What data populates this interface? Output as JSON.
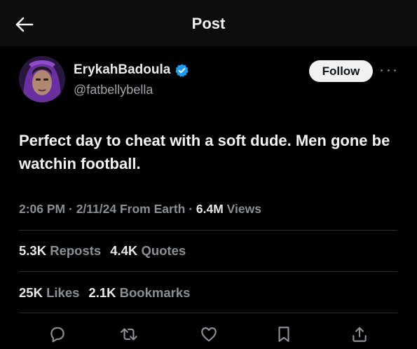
{
  "header": {
    "title": "Post",
    "back_icon": "arrow-left-icon"
  },
  "author": {
    "name": "ErykahBadoula",
    "handle": "@fatbellybella",
    "verified_icon": "verified-badge-icon",
    "verified_color": "#1d9bf0"
  },
  "follow_label": "Follow",
  "post": {
    "text": "Perfect day to cheat with a soft dude. Men gone be watchin football."
  },
  "meta": {
    "time": "2:06 PM",
    "sep1": " · ",
    "date": "2/11/24",
    "location": " From Earth",
    "sep2": " · ",
    "views_count": "6.4M",
    "views_label": " Views"
  },
  "stats": {
    "reposts_count": "5.3K",
    "reposts_label": "Reposts",
    "quotes_count": "4.4K",
    "quotes_label": "Quotes",
    "likes_count": "25K",
    "likes_label": "Likes",
    "bookmarks_count": "2.1K",
    "bookmarks_label": "Bookmarks"
  },
  "actions": [
    "reply-icon",
    "repost-icon",
    "like-icon",
    "bookmark-icon",
    "share-icon"
  ],
  "colors": {
    "background": "#000000",
    "text": "#e7e9ea",
    "muted": "#8b8f94"
  }
}
